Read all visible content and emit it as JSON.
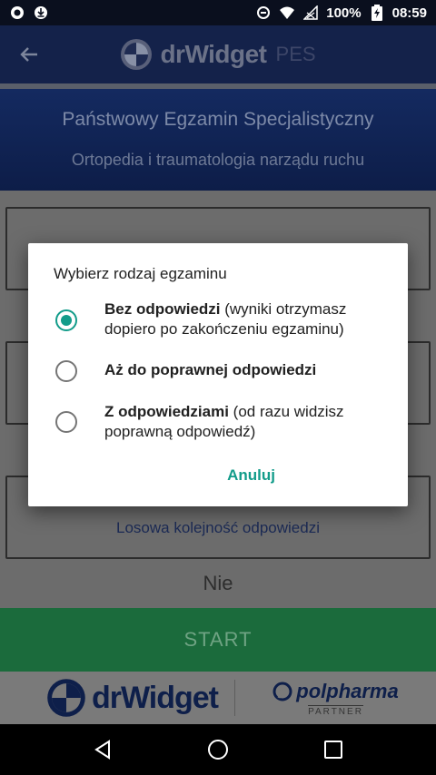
{
  "status_bar": {
    "battery": "100%",
    "time": "08:59"
  },
  "app_bar": {
    "logo_text": "drWidget",
    "logo_suffix": "PES"
  },
  "header": {
    "title": "Państwowy Egzamin Specjalistyczny",
    "subtitle": "Ortopedia i traumatologia narządu ruchu"
  },
  "main": {
    "card3_label": "Losowa kolejność odpowiedzi",
    "nie_label": "Nie",
    "start_label": "START"
  },
  "footer": {
    "brand_left": "drWidget",
    "brand_right": "polpharma",
    "partner_label": "PARTNER"
  },
  "dialog": {
    "title": "Wybierz rodzaj egzaminu",
    "options": [
      {
        "bold": "Bez odpowiedzi",
        "rest": " (wyniki otrzymasz dopiero po zakończeniu egzaminu)",
        "checked": true
      },
      {
        "bold": "Aż do poprawnej odpowiedzi",
        "rest": "",
        "checked": false
      },
      {
        "bold": "Z odpowiedziami",
        "rest": " (od razu widzisz poprawną odpowiedź)",
        "checked": false
      }
    ],
    "cancel_label": "Anuluj"
  },
  "colors": {
    "accent": "#129c8a",
    "app_bar": "#14224a",
    "start": "#1b6b3c"
  }
}
